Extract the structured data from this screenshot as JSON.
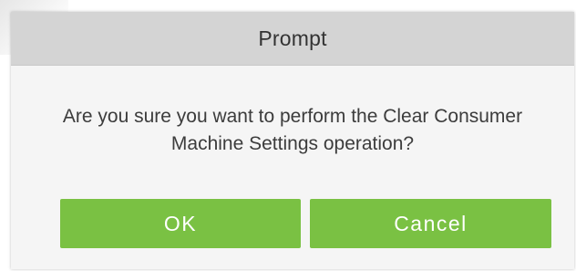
{
  "dialog": {
    "title": "Prompt",
    "message": "Are you sure you want to perform the Clear Consumer Machine Settings operation?",
    "ok_label": "OK",
    "cancel_label": "Cancel"
  },
  "colors": {
    "header_background": "#d4d4d4",
    "body_background": "#f5f5f5",
    "button_background": "#7ac143",
    "button_text": "#ffffff"
  }
}
